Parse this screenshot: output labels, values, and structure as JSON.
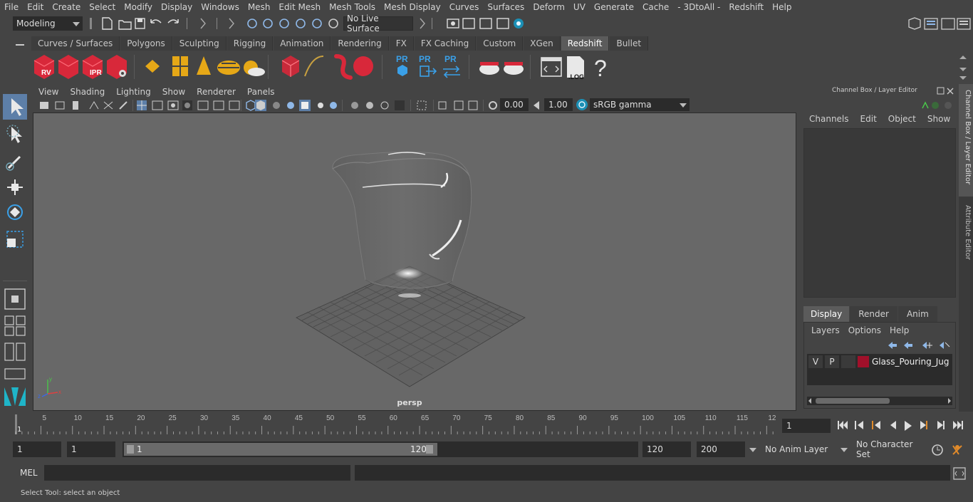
{
  "menu": [
    "File",
    "Edit",
    "Create",
    "Select",
    "Modify",
    "Display",
    "Windows",
    "Mesh",
    "Edit Mesh",
    "Mesh Tools",
    "Mesh Display",
    "Curves",
    "Surfaces",
    "Deform",
    "UV",
    "Generate",
    "Cache",
    "- 3DtoAll -",
    "Redshift",
    "Help"
  ],
  "status": {
    "mode": "Modeling",
    "live_surface": "No Live Surface"
  },
  "shelf_tabs": [
    "Curves / Surfaces",
    "Polygons",
    "Sculpting",
    "Rigging",
    "Animation",
    "Rendering",
    "FX",
    "FX Caching",
    "Custom",
    "XGen",
    "Redshift",
    "Bullet"
  ],
  "active_shelf_tab": "Redshift",
  "shelf_icons": {
    "rv": "RV",
    "ipr": "IPR",
    "pr1": "PR",
    "pr2": "PR",
    "pr3": "PR",
    "log": ".LOG",
    "help": "?"
  },
  "viewport": {
    "menu": [
      "View",
      "Shading",
      "Lighting",
      "Show",
      "Renderer",
      "Panels"
    ],
    "exposure": "0.00",
    "gamma": "1.00",
    "color_space": "sRGB gamma",
    "camera_label": "persp"
  },
  "channel_box": {
    "title": "Channel Box / Layer Editor",
    "menu": [
      "Channels",
      "Edit",
      "Object",
      "Show"
    ]
  },
  "layer_editor": {
    "tabs": [
      "Display",
      "Render",
      "Anim"
    ],
    "active_tab": "Display",
    "menu": [
      "Layers",
      "Options",
      "Help"
    ],
    "layers": [
      {
        "v": "V",
        "p": "P",
        "color": "#a0102a",
        "name": "Glass_Pouring_Jug"
      }
    ]
  },
  "side_tabs": [
    "Channel Box / Layer Editor",
    "Attribute Editor"
  ],
  "timeline": {
    "ticks": [
      "5",
      "10",
      "15",
      "20",
      "25",
      "30",
      "35",
      "40",
      "45",
      "50",
      "55",
      "60",
      "65",
      "70",
      "75",
      "80",
      "85",
      "90",
      "95",
      "100",
      "105",
      "110",
      "115",
      "12"
    ],
    "current_frame_marker": "1",
    "current_frame": "1"
  },
  "range": {
    "start": "1",
    "playback_start": "1",
    "slider_start": "1",
    "slider_end": "120",
    "playback_end": "120",
    "end": "200",
    "anim_layer": "No Anim Layer",
    "character_set": "No Character Set"
  },
  "command": {
    "lang": "MEL"
  },
  "help_line": "Select Tool: select an object",
  "colors": {
    "redshift_red": "#d8283a",
    "gold": "#e6a817",
    "teal": "#1fb5c8",
    "layer_color": "#a0102a"
  }
}
